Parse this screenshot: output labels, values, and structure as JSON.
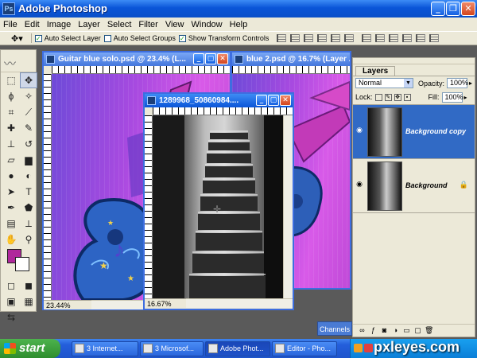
{
  "app": {
    "title": "Adobe Photoshop"
  },
  "menu": [
    "File",
    "Edit",
    "Image",
    "Layer",
    "Select",
    "Filter",
    "View",
    "Window",
    "Help"
  ],
  "options": {
    "auto_select_layer": "Auto Select Layer",
    "auto_select_groups": "Auto Select Groups",
    "show_transform_controls": "Show Transform Controls"
  },
  "documents": {
    "guitar": {
      "title": "Guitar blue solo.psd @ 23.4% (L...",
      "zoom": "23.44%"
    },
    "blue2": {
      "title": "blue 2.psd @ 16.7% (Layer ..."
    },
    "stairs": {
      "title": "1289968_50860984....",
      "zoom": "16.67%"
    }
  },
  "layers_panel": {
    "tab": "Layers",
    "blend_mode": "Normal",
    "opacity_label": "Opacity:",
    "opacity_value": "100%",
    "lock_label": "Lock:",
    "fill_label": "Fill:",
    "fill_value": "100%",
    "layers": [
      {
        "name": "Background copy",
        "selected": true
      },
      {
        "name": "Background",
        "selected": false
      }
    ]
  },
  "channels_tab": "Channels",
  "taskbar": {
    "start": "start",
    "tasks": [
      "3 Internet...",
      "3 Microsof...",
      "Adobe Phot...",
      "Editor - Pho..."
    ]
  },
  "watermark": "pxleyes.com",
  "colors": {
    "foreground": "#b0289c",
    "background": "#ffffff",
    "accent": "#0a55d8"
  }
}
